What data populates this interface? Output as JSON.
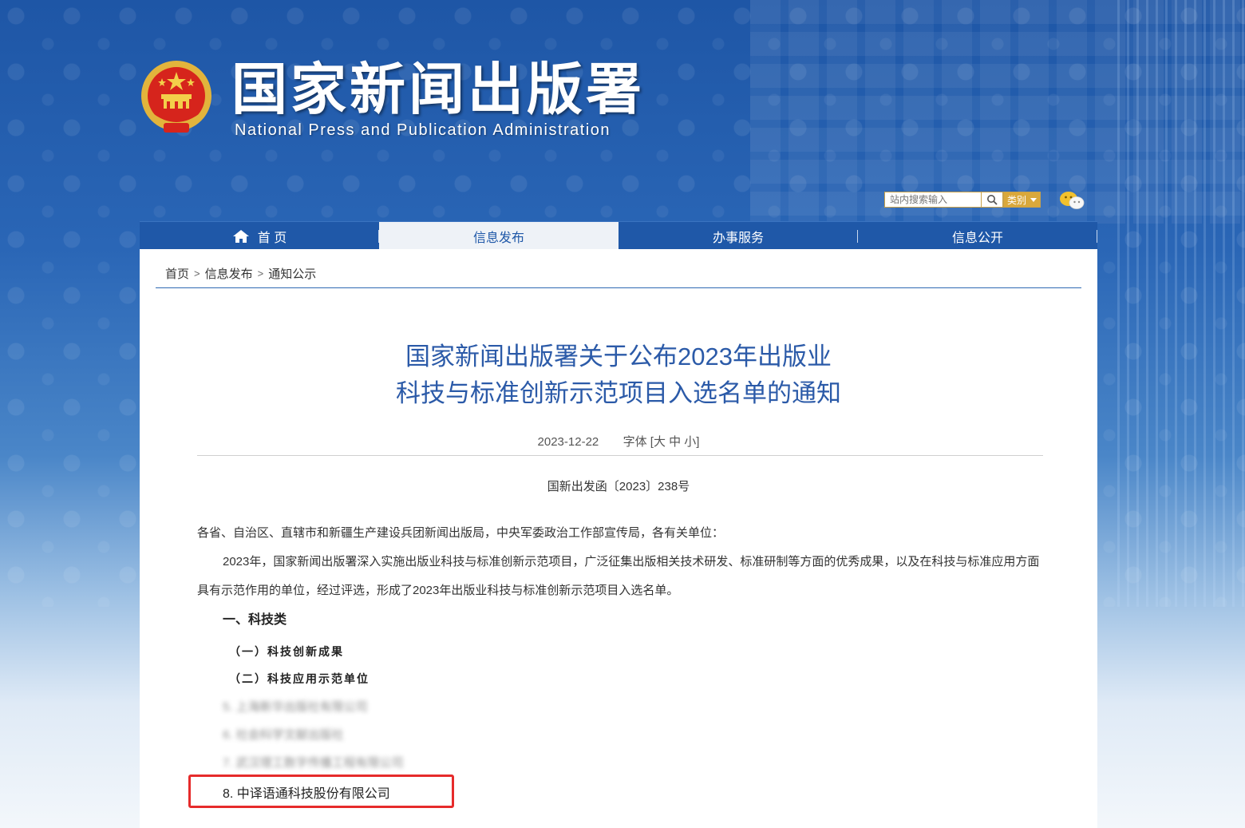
{
  "site": {
    "title": "国家新闻出版署",
    "subtitle": "National  Press and Publication Administration"
  },
  "search": {
    "placeholder": "站内搜索输入",
    "category_label": "类别"
  },
  "nav": {
    "items": [
      {
        "label": "首 页"
      },
      {
        "label": "信息发布"
      },
      {
        "label": "办事服务"
      },
      {
        "label": "信息公开"
      }
    ],
    "active_index": 1
  },
  "breadcrumb": [
    "首页",
    "信息发布",
    "通知公示"
  ],
  "breadcrumb_sep": ">",
  "article": {
    "title_line1": "国家新闻出版署关于公布2023年出版业",
    "title_line2": "科技与标准创新示范项目入选名单的通知",
    "date": "2023-12-22",
    "font_label": "字体",
    "font_sizes": "[大 中 小]",
    "doc_number": "国新出发函〔2023〕238号",
    "salutation": "各省、自治区、直辖市和新疆生产建设兵团新闻出版局，中央军委政治工作部宣传局，各有关单位：",
    "paragraph1": "2023年，国家新闻出版署深入实施出版业科技与标准创新示范项目，广泛征集出版相关技术研发、标准研制等方面的优秀成果，以及在科技与标准应用方面具有示范作用的单位，经过评选，形成了2023年出版业科技与标准创新示范项目入选名单。",
    "section1": "一、科技类",
    "sub1": "（一）科技创新成果",
    "sub2": "（二）科技应用示范单位",
    "blurred_items": [
      "5. 上海新华出版社有限公司",
      "6. 社会科学文献出版社",
      "7. 武汉理工数字传播工程有限公司"
    ],
    "item8": "8. 中译语通科技股份有限公司"
  },
  "colors": {
    "brand_blue": "#1f58a8",
    "title_blue": "#2b5aa8",
    "highlight_red": "#e62b2b",
    "category_gold": "#d9a83b"
  }
}
